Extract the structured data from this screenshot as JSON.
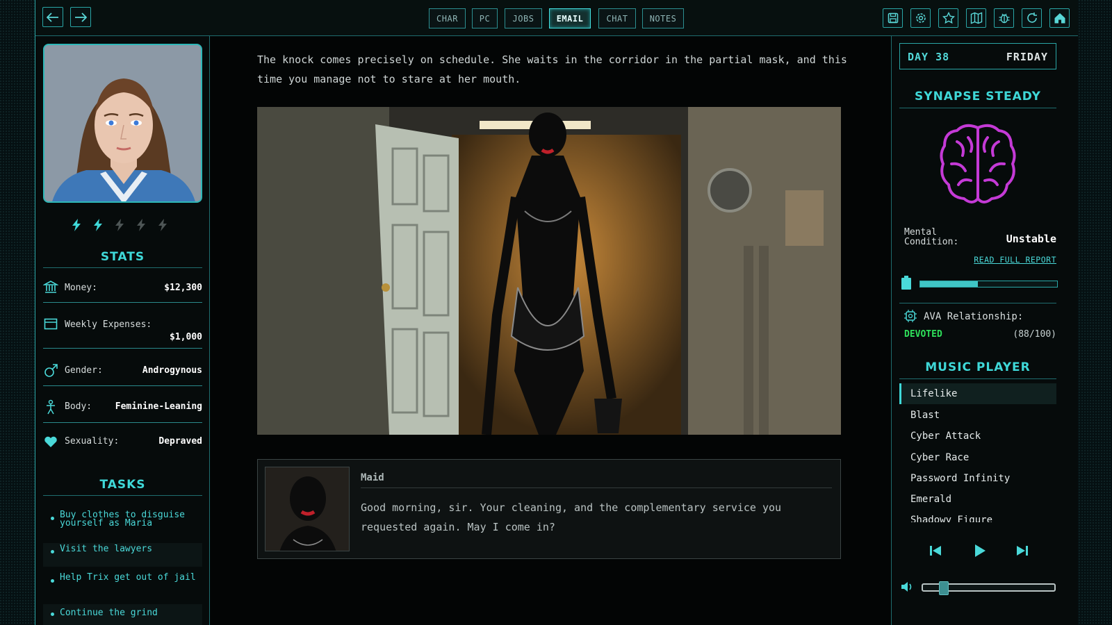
{
  "nav": {
    "tabs": [
      {
        "label": "CHAR",
        "active": false
      },
      {
        "label": "PC",
        "active": false
      },
      {
        "label": "JOBS",
        "active": false
      },
      {
        "label": "EMAIL",
        "active": true
      },
      {
        "label": "CHAT",
        "active": false
      },
      {
        "label": "NOTES",
        "active": false
      }
    ],
    "icons": [
      "arrow-left-icon",
      "arrow-right-icon",
      "save-icon",
      "settings-icon",
      "star-icon",
      "map-icon",
      "bug-icon",
      "refresh-icon",
      "home-icon"
    ]
  },
  "character": {
    "energy": {
      "filled": 2,
      "total": 5
    },
    "stats_title": "STATS",
    "stats": [
      {
        "label": "Money:",
        "value": "$12,300",
        "icon": "bank-icon"
      },
      {
        "label": "Weekly Expenses:",
        "value": "$1,000",
        "icon": "wallet-icon"
      },
      {
        "label": "Gender:",
        "value": "Androgynous",
        "icon": "gender-icon"
      },
      {
        "label": "Body:",
        "value": "Feminine-Leaning",
        "icon": "body-icon"
      },
      {
        "label": "Sexuality:",
        "value": "Depraved",
        "icon": "heart-icon"
      }
    ],
    "tasks_title": "TASKS",
    "tasks": [
      "Buy clothes to disguise yourself as Maria",
      "Visit the lawyers",
      "Help Trix get out of jail",
      "Continue the grind"
    ]
  },
  "story": {
    "narration": "The knock comes precisely on schedule. She waits in the corridor in the partial mask, and this time you manage not to stare at her mouth.",
    "dialog": {
      "speaker": "Maid",
      "text": "Good morning, sir. Your cleaning, and the complementary service you requested again. May I come in?"
    }
  },
  "sidebar": {
    "day_label": "DAY 38",
    "weekday": "FRIDAY",
    "synapse_title": "SYNAPSE STEADY",
    "mental_label_1": "Mental",
    "mental_label_2": "Condition:",
    "mental_value": "Unstable",
    "report_link": "READ FULL REPORT",
    "mental_bar_fraction": 0.42,
    "ava_label": "AVA Relationship:",
    "ava_status": "DEVOTED",
    "ava_score": "(88/100)",
    "music_title": "MUSIC PLAYER",
    "tracks": [
      "Lifelike",
      "Blast",
      "Cyber Attack",
      "Cyber Race",
      "Password Infinity",
      "Emerald",
      "Shadowy Figure"
    ],
    "active_track": 0,
    "volume_fraction": 0.12
  },
  "colors": {
    "accent": "#3fd8d8",
    "brain": "#c43ad6",
    "devoted": "#2ee05a"
  }
}
